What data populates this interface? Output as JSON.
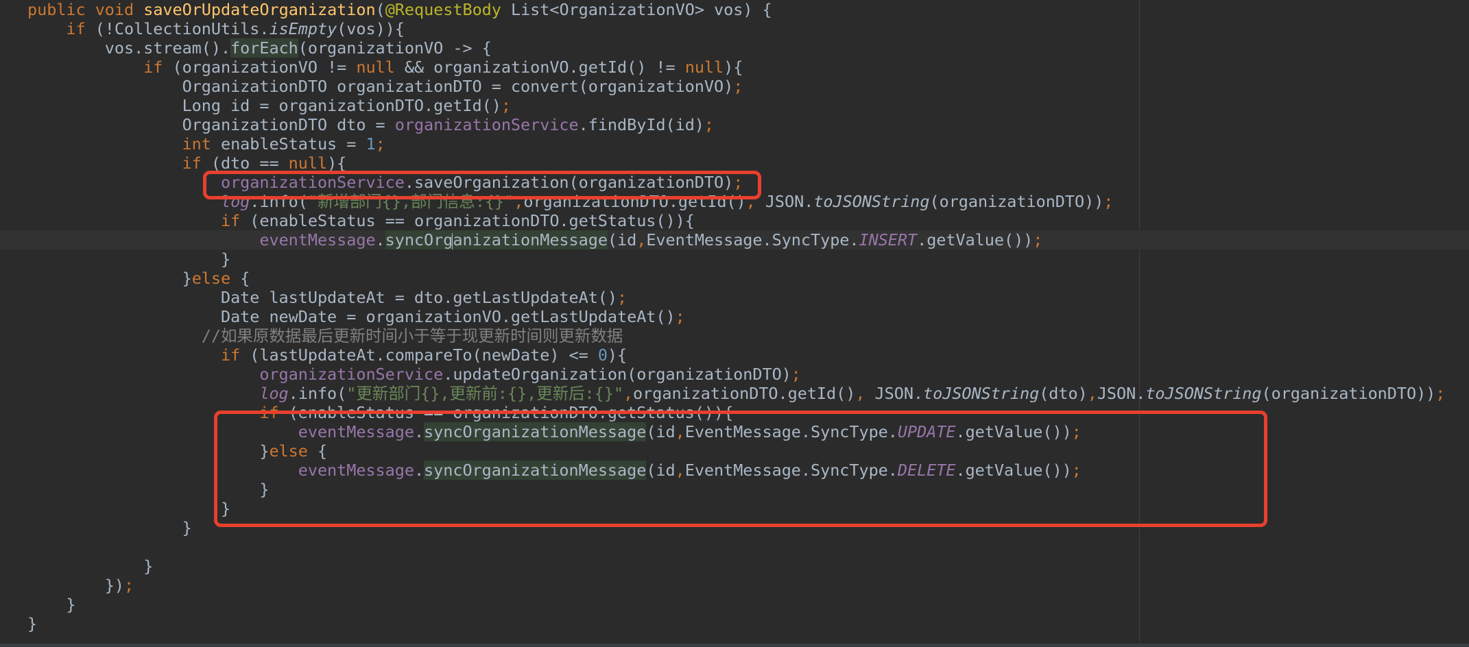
{
  "editor": {
    "lines": [
      {
        "indent": "",
        "tokens": [
          {
            "t": "public",
            "c": "kw"
          },
          {
            "t": " "
          },
          {
            "t": "void",
            "c": "kw"
          },
          {
            "t": " "
          },
          {
            "t": "saveOrUpdateOrganization",
            "c": "fn"
          },
          {
            "t": "("
          },
          {
            "t": "@RequestBody",
            "c": "anno"
          },
          {
            "t": " List<OrganizationVO> vos) {"
          }
        ]
      },
      {
        "indent": "    ",
        "tokens": [
          {
            "t": "if",
            "c": "kw"
          },
          {
            "t": " (!CollectionUtils."
          },
          {
            "t": "isEmpty",
            "c": "static-call"
          },
          {
            "t": "(vos)){"
          }
        ]
      },
      {
        "indent": "        ",
        "tokens": [
          {
            "t": "vos.stream()."
          },
          {
            "t": "forEach",
            "c": "hl"
          },
          {
            "t": "(organizationVO -> {"
          }
        ]
      },
      {
        "indent": "            ",
        "tokens": [
          {
            "t": "if",
            "c": "kw"
          },
          {
            "t": " (organizationVO != "
          },
          {
            "t": "null",
            "c": "kw"
          },
          {
            "t": " && organizationVO.getId() != "
          },
          {
            "t": "null",
            "c": "kw"
          },
          {
            "t": "){"
          }
        ]
      },
      {
        "indent": "                ",
        "tokens": [
          {
            "t": "OrganizationDTO organizationDTO = convert(organizationVO)"
          },
          {
            "t": ";",
            "c": "kw"
          }
        ]
      },
      {
        "indent": "                ",
        "tokens": [
          {
            "t": "Long id = organizationDTO.getId()"
          },
          {
            "t": ";",
            "c": "kw"
          }
        ]
      },
      {
        "indent": "                ",
        "tokens": [
          {
            "t": "OrganizationDTO dto = "
          },
          {
            "t": "organizationService",
            "c": "field"
          },
          {
            "t": ".findById(id)"
          },
          {
            "t": ";",
            "c": "kw"
          }
        ]
      },
      {
        "indent": "                ",
        "tokens": [
          {
            "t": "int",
            "c": "kw"
          },
          {
            "t": " enableStatus = "
          },
          {
            "t": "1",
            "c": "num"
          },
          {
            "t": ";",
            "c": "kw"
          }
        ]
      },
      {
        "indent": "                ",
        "tokens": [
          {
            "t": "if",
            "c": "kw"
          },
          {
            "t": " (dto == "
          },
          {
            "t": "null",
            "c": "kw"
          },
          {
            "t": "){"
          }
        ]
      },
      {
        "indent": "                    ",
        "tokens": [
          {
            "t": "organizationService",
            "c": "field"
          },
          {
            "t": ".saveOrganization(organizationDTO)"
          },
          {
            "t": ";",
            "c": "kw"
          }
        ]
      },
      {
        "indent": "                    ",
        "tokens": [
          {
            "t": "log",
            "c": "field italic"
          },
          {
            "t": ".info("
          },
          {
            "t": "\"新增部门{},部门信息:{}\"",
            "c": "str"
          },
          {
            "t": ",",
            "c": "kw"
          },
          {
            "t": "organizationDTO.getId()"
          },
          {
            "t": ",",
            "c": "kw"
          },
          {
            "t": " JSON."
          },
          {
            "t": "toJSONString",
            "c": "static-call"
          },
          {
            "t": "(organizationDTO))"
          },
          {
            "t": ";",
            "c": "kw"
          }
        ]
      },
      {
        "indent": "                    ",
        "tokens": [
          {
            "t": "if",
            "c": "kw"
          },
          {
            "t": " (enableStatus == organizationDTO.getStatus()){"
          }
        ]
      },
      {
        "indent": "                        ",
        "current": true,
        "caret_after": 2,
        "tokens": [
          {
            "t": "eventMessage",
            "c": "field"
          },
          {
            "t": "."
          },
          {
            "t": "syncOrg",
            "c": "hl"
          },
          {
            "t": "anizationMessage",
            "c": "hl"
          },
          {
            "t": "(id"
          },
          {
            "t": ",",
            "c": "kw"
          },
          {
            "t": "EventMessage.SyncType."
          },
          {
            "t": "INSERT",
            "c": "field italic"
          },
          {
            "t": ".getValue())"
          },
          {
            "t": ";",
            "c": "kw"
          }
        ]
      },
      {
        "indent": "                    ",
        "tokens": [
          {
            "t": "}"
          }
        ]
      },
      {
        "indent": "                ",
        "tokens": [
          {
            "t": "}"
          },
          {
            "t": "else",
            "c": "kw"
          },
          {
            "t": " {"
          }
        ]
      },
      {
        "indent": "                    ",
        "tokens": [
          {
            "t": "Date lastUpdateAt = dto.getLastUpdateAt()"
          },
          {
            "t": ";",
            "c": "kw"
          }
        ]
      },
      {
        "indent": "                    ",
        "tokens": [
          {
            "t": "Date newDate = organizationVO.getLastUpdateAt()"
          },
          {
            "t": ";",
            "c": "kw"
          }
        ]
      },
      {
        "indent": "                  ",
        "tokens": [
          {
            "t": "//如果原数据最后更新时间小于等于现更新时间则更新数据",
            "c": "cmt"
          }
        ]
      },
      {
        "indent": "                    ",
        "tokens": [
          {
            "t": "if",
            "c": "kw"
          },
          {
            "t": " (lastUpdateAt.compareTo(newDate) <= "
          },
          {
            "t": "0",
            "c": "num"
          },
          {
            "t": "){"
          }
        ]
      },
      {
        "indent": "                        ",
        "tokens": [
          {
            "t": "organizationService",
            "c": "field"
          },
          {
            "t": ".updateOrganization(organizationDTO)"
          },
          {
            "t": ";",
            "c": "kw"
          }
        ]
      },
      {
        "indent": "                        ",
        "tokens": [
          {
            "t": "log",
            "c": "field italic"
          },
          {
            "t": ".info("
          },
          {
            "t": "\"更新部门{},更新前:{},更新后:{}\"",
            "c": "str"
          },
          {
            "t": ",",
            "c": "kw"
          },
          {
            "t": "organizationDTO.getId()"
          },
          {
            "t": ",",
            "c": "kw"
          },
          {
            "t": " JSON."
          },
          {
            "t": "toJSONString",
            "c": "static-call"
          },
          {
            "t": "(dto)"
          },
          {
            "t": ",",
            "c": "kw"
          },
          {
            "t": "JSON."
          },
          {
            "t": "toJSONString",
            "c": "static-call"
          },
          {
            "t": "(organizationDTO))"
          },
          {
            "t": ";",
            "c": "kw"
          }
        ]
      },
      {
        "indent": "                        ",
        "tokens": [
          {
            "t": "if",
            "c": "kw"
          },
          {
            "t": " (enableStatus == organizationDTO.getStatus()){"
          }
        ]
      },
      {
        "indent": "                            ",
        "tokens": [
          {
            "t": "eventMessage",
            "c": "field"
          },
          {
            "t": "."
          },
          {
            "t": "syncOrganizationMessage",
            "c": "hl"
          },
          {
            "t": "(id"
          },
          {
            "t": ",",
            "c": "kw"
          },
          {
            "t": "EventMessage.SyncType."
          },
          {
            "t": "UPDATE",
            "c": "field italic"
          },
          {
            "t": ".getValue())"
          },
          {
            "t": ";",
            "c": "kw"
          }
        ]
      },
      {
        "indent": "                        ",
        "tokens": [
          {
            "t": "}"
          },
          {
            "t": "else",
            "c": "kw"
          },
          {
            "t": " {"
          }
        ]
      },
      {
        "indent": "                            ",
        "tokens": [
          {
            "t": "eventMessage",
            "c": "field"
          },
          {
            "t": "."
          },
          {
            "t": "syncOrganizationMessage",
            "c": "hl"
          },
          {
            "t": "(id"
          },
          {
            "t": ",",
            "c": "kw"
          },
          {
            "t": "EventMessage.SyncType."
          },
          {
            "t": "DELETE",
            "c": "field italic"
          },
          {
            "t": ".getValue())"
          },
          {
            "t": ";",
            "c": "kw"
          }
        ]
      },
      {
        "indent": "                        ",
        "tokens": [
          {
            "t": "}"
          }
        ]
      },
      {
        "indent": "                    ",
        "tokens": [
          {
            "t": "}"
          }
        ]
      },
      {
        "indent": "                ",
        "tokens": [
          {
            "t": "}"
          }
        ]
      },
      {
        "indent": "",
        "tokens": []
      },
      {
        "indent": "            ",
        "tokens": [
          {
            "t": "}"
          }
        ]
      },
      {
        "indent": "        ",
        "tokens": [
          {
            "t": "})"
          },
          {
            "t": ";",
            "c": "kw"
          }
        ]
      },
      {
        "indent": "    ",
        "tokens": [
          {
            "t": "}"
          }
        ]
      },
      {
        "indent": "",
        "tokens": [
          {
            "t": "}"
          }
        ]
      }
    ]
  },
  "annotations": [
    {
      "label": "red-highlight-box"
    },
    {
      "label": "red-highlight-box"
    }
  ],
  "colors": {
    "background": "#2b2b2b",
    "keyword": "#cc7832",
    "method_declaration": "#ffc66d",
    "annotation": "#bbb529",
    "field": "#9876aa",
    "number": "#6897bb",
    "string": "#6a8759",
    "comment": "#808080",
    "default_text": "#a9b7c6",
    "red_box": "#e8402e"
  }
}
